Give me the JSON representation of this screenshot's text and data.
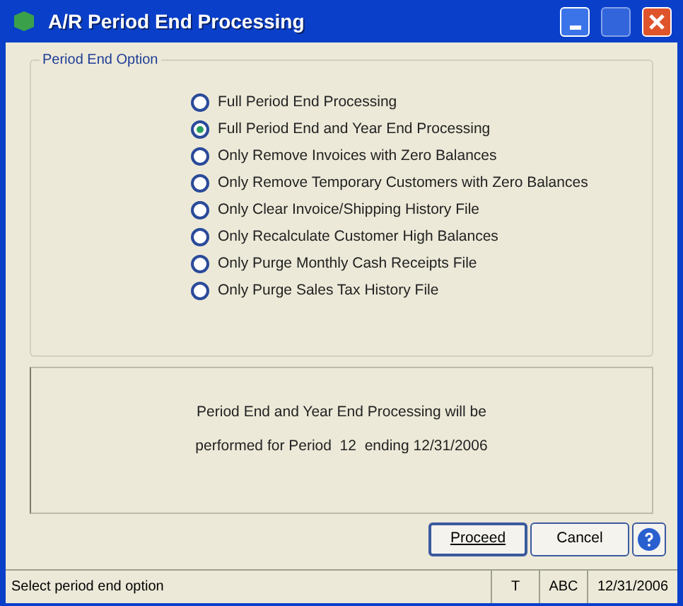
{
  "window": {
    "title": "A/R Period End Processing"
  },
  "group": {
    "title": "Period End Option",
    "options": [
      {
        "label": "Full Period End Processing",
        "selected": false
      },
      {
        "label": "Full Period End and Year End Processing",
        "selected": true
      },
      {
        "label": "Only Remove Invoices with Zero Balances",
        "selected": false
      },
      {
        "label": "Only Remove Temporary Customers with Zero Balances",
        "selected": false
      },
      {
        "label": "Only Clear Invoice/Shipping History File",
        "selected": false
      },
      {
        "label": "Only Recalculate Customer High Balances",
        "selected": false
      },
      {
        "label": "Only Purge Monthly Cash Receipts File",
        "selected": false
      },
      {
        "label": "Only Purge Sales Tax History File",
        "selected": false
      }
    ]
  },
  "message": [
    "Period End and Year End Processing will be",
    "performed for Period  12  ending 12/31/2006"
  ],
  "buttons": [
    "Proceed",
    "Cancel"
  ],
  "status_bar": {
    "text": "Select period end option",
    "fields": [
      "T",
      "ABC",
      "12/31/2006"
    ]
  }
}
